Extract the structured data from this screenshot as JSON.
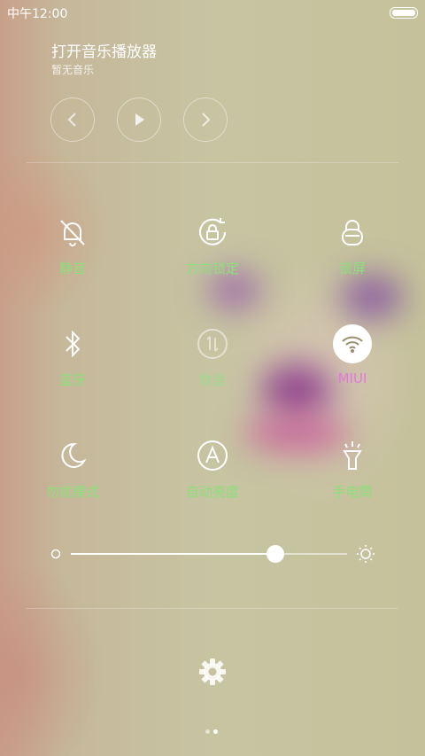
{
  "status_bar": {
    "time": "中午12:00"
  },
  "music": {
    "title": "打开音乐播放器",
    "subtitle": "暂无音乐",
    "controls": [
      "previous-icon",
      "play-icon",
      "next-icon"
    ]
  },
  "toggles": [
    {
      "label": "静音",
      "icon": "mute-bell-icon",
      "state": "off"
    },
    {
      "label": "方向锁定",
      "icon": "rotation-lock-icon",
      "state": "off"
    },
    {
      "label": "锁屏",
      "icon": "lock-icon",
      "state": "off"
    },
    {
      "label": "蓝牙",
      "icon": "bluetooth-icon",
      "state": "off"
    },
    {
      "label": "数据",
      "icon": "mobile-data-icon",
      "state": "disabled"
    },
    {
      "label": "MIUI",
      "icon": "wifi-icon",
      "state": "on"
    },
    {
      "label": "勿扰模式",
      "icon": "moon-icon",
      "state": "off"
    },
    {
      "label": "自动亮度",
      "icon": "auto-brightness-icon",
      "state": "off"
    },
    {
      "label": "手电筒",
      "icon": "flashlight-icon",
      "state": "off"
    }
  ],
  "brightness": {
    "level": 0.74
  },
  "footer": {
    "settings_icon": "gear-icon",
    "pages": 2,
    "current_page": 2
  },
  "colors": {
    "label": "#8be07a",
    "active_label": "#e07ad8"
  }
}
